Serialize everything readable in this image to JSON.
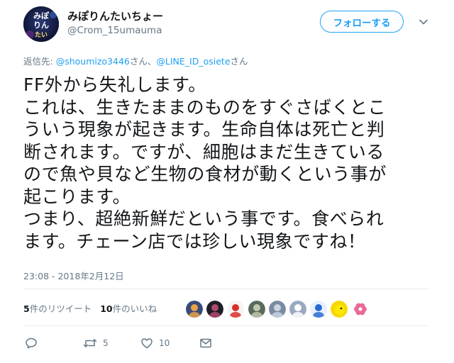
{
  "user": {
    "display_name": "みぽりんたいちょー",
    "screen_name": "@Crom_15umauma",
    "avatar_text": [
      "みぽ",
      "りん",
      "たい"
    ]
  },
  "header": {
    "follow_label": "フォローする",
    "caret_icon": "chevron-down-icon"
  },
  "reply": {
    "prefix": "返信先: ",
    "mention1": "@shoumizo3446",
    "suffix1": "さん、",
    "mention2": "@LINE_ID_osiete",
    "suffix2": "さん"
  },
  "tweet": {
    "lines": [
      "FF外から失礼します。",
      "これは、生きたままのものをすぐさばくとこ",
      "ういう現象が起きます。生命自体は死亡と判",
      "断されます。ですが、細胞はまだ生きている",
      "ので魚や貝など生物の食材が動くという事が",
      "起こります。",
      "つまり、超絶新鮮だという事です。食べられ",
      "ます。チェーン店では珍しい現象ですね！"
    ],
    "timestamp": "23:08 - 2018年2月12日"
  },
  "stats": {
    "retweet_count": "5",
    "retweet_label": "件のリツイート",
    "like_count": "10",
    "like_label": "件のいいね"
  },
  "likers": [
    {
      "name": "liker-avatar-1",
      "bg": "#3a4a7a",
      "fg": "#e8a24a"
    },
    {
      "name": "liker-avatar-2",
      "bg": "#1e1e2a",
      "fg": "#b04a6a"
    },
    {
      "name": "liker-avatar-3",
      "bg": "#f4f4f4",
      "fg": "#d9302c"
    },
    {
      "name": "liker-avatar-4",
      "bg": "#5a6a5a",
      "fg": "#c0c8b0"
    },
    {
      "name": "liker-avatar-5",
      "bg": "#7a8aa0",
      "fg": "#c8d4e0"
    },
    {
      "name": "liker-avatar-6",
      "bg": "#9aa8c0",
      "fg": "#ffffff"
    },
    {
      "name": "liker-avatar-7",
      "bg": "#e8f0ff",
      "fg": "#2a6ad0"
    },
    {
      "name": "liker-avatar-8",
      "bg": "#f5d800",
      "fg": "#1a1a1a"
    },
    {
      "name": "liker-avatar-9",
      "bg": "#ffffff",
      "fg": "#e86a9a"
    }
  ],
  "actions": {
    "reply_icon": "reply-icon",
    "retweet_icon": "retweet-icon",
    "retweet_count": "5",
    "like_icon": "heart-icon",
    "like_count": "10",
    "dm_icon": "direct-message-icon"
  },
  "colors": {
    "accent": "#1da1f2",
    "secondary_text": "#657786",
    "primary_text": "#14171a",
    "divider": "#e6ecf0"
  }
}
